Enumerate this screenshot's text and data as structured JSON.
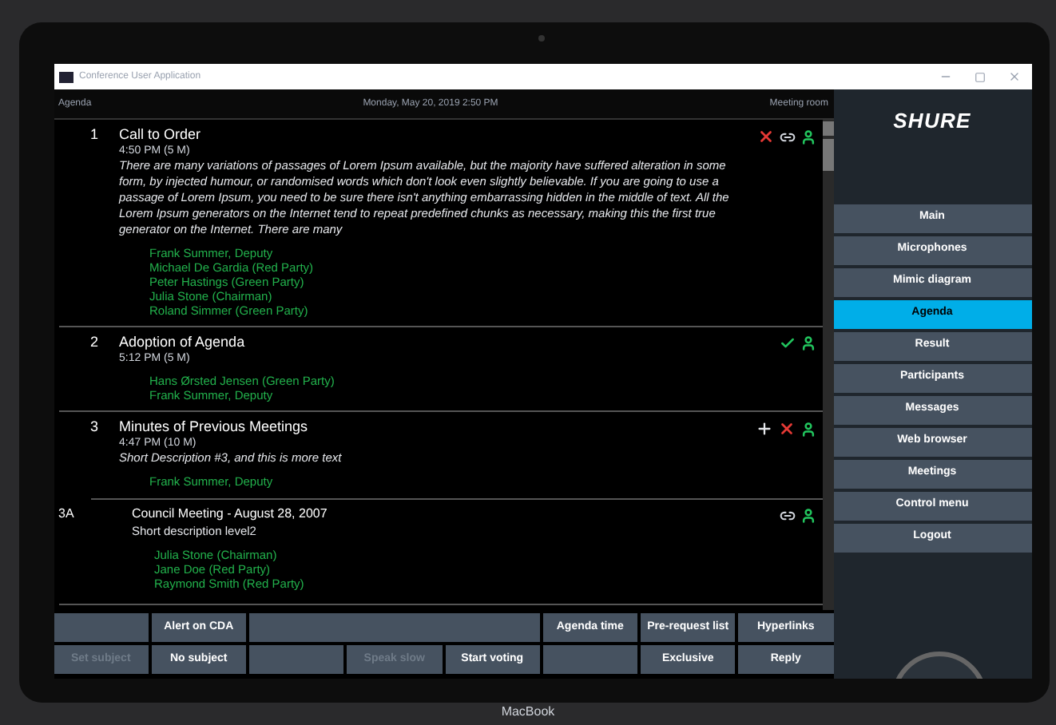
{
  "window": {
    "title": "Conference User Application"
  },
  "header": {
    "left": "Agenda",
    "center": "Monday, May 20, 2019 2:50 PM",
    "right": "Meeting room"
  },
  "agenda": [
    {
      "number": "1",
      "title": "Call to Order",
      "time": "4:50 PM (5 M)",
      "description": "There are many variations of passages of Lorem Ipsum available, but the majority have suffered alteration in some form, by injected humour, or randomised words which don't look even slightly believable. If you are going to use a passage of Lorem Ipsum, you need to be sure there isn't anything embarrassing hidden in the middle of text. All the Lorem Ipsum generators on the Internet tend to repeat predefined chunks as necessary, making this the first true generator on the Internet. There are many",
      "actions": [
        {
          "kind": "remove"
        },
        {
          "kind": "link"
        },
        {
          "kind": "speaker"
        }
      ],
      "participants": [
        "Frank Summer,  Deputy",
        "Michael De Gardia (Red Party)",
        "Peter Hastings (Green Party)",
        "Julia Stone (Chairman)",
        "Roland  Simmer (Green Party)"
      ]
    },
    {
      "number": "2",
      "title": "Adoption of Agenda",
      "time": "5:12 PM (5 M)",
      "actions": [
        {
          "kind": "approved"
        },
        {
          "kind": "speaker"
        }
      ],
      "participants": [
        "Hans Ørsted Jensen  (Green Party)",
        "Frank Summer,  Deputy"
      ]
    },
    {
      "number": "3",
      "title": "Minutes of Previous Meetings",
      "time": "4:47 PM (10 M)",
      "description": "Short Description #3, and this is more text",
      "actions": [
        {
          "kind": "add"
        },
        {
          "kind": "remove"
        },
        {
          "kind": "speaker"
        }
      ],
      "participants": [
        "Frank Summer,  Deputy"
      ],
      "children": [
        {
          "number": "3A",
          "title": "Council Meeting - August 28, 2007",
          "description": "Short description level2",
          "actions": [
            {
              "kind": "link"
            },
            {
              "kind": "speaker"
            }
          ],
          "participants": [
            "Julia Stone (Chairman)",
            "Jane Doe  (Red Party)",
            "Raymond Smith (Red Party)"
          ]
        }
      ]
    }
  ],
  "button_rows": [
    [
      {
        "kind": "blank"
      },
      {
        "kind": "button",
        "label": "Alert on CDA",
        "disabled": false
      },
      {
        "kind": "blank"
      },
      {
        "kind": "blank"
      },
      {
        "kind": "blank"
      },
      {
        "kind": "button",
        "label": "Agenda time",
        "disabled": false
      },
      {
        "kind": "button",
        "label": "Pre-request list",
        "disabled": false
      },
      {
        "kind": "button",
        "label": "Hyperlinks",
        "disabled": false
      }
    ],
    [
      {
        "kind": "button",
        "label": "Set subject",
        "disabled": true
      },
      {
        "kind": "button",
        "label": "No subject",
        "disabled": false
      },
      {
        "kind": "blank"
      },
      {
        "kind": "button",
        "label": "Speak slow",
        "disabled": true
      },
      {
        "kind": "button",
        "label": "Start voting",
        "disabled": false
      },
      {
        "kind": "blank"
      },
      {
        "kind": "button",
        "label": "Exclusive",
        "disabled": false
      },
      {
        "kind": "button",
        "label": "Reply",
        "disabled": false
      }
    ]
  ],
  "sidebar": {
    "logo": "SHURE",
    "items": [
      {
        "label": "Main",
        "selected": false
      },
      {
        "label": "Microphones",
        "selected": false
      },
      {
        "label": "Mimic diagram",
        "selected": false
      },
      {
        "label": "Agenda",
        "selected": true
      },
      {
        "label": "Result",
        "selected": false
      },
      {
        "label": "Participants",
        "selected": false
      },
      {
        "label": "Messages",
        "selected": false
      },
      {
        "label": "Web browser",
        "selected": false
      },
      {
        "label": "Meetings",
        "selected": false
      },
      {
        "label": "Control menu",
        "selected": false
      },
      {
        "label": "Logout",
        "selected": false
      }
    ]
  },
  "device": {
    "label": "MacBook"
  }
}
